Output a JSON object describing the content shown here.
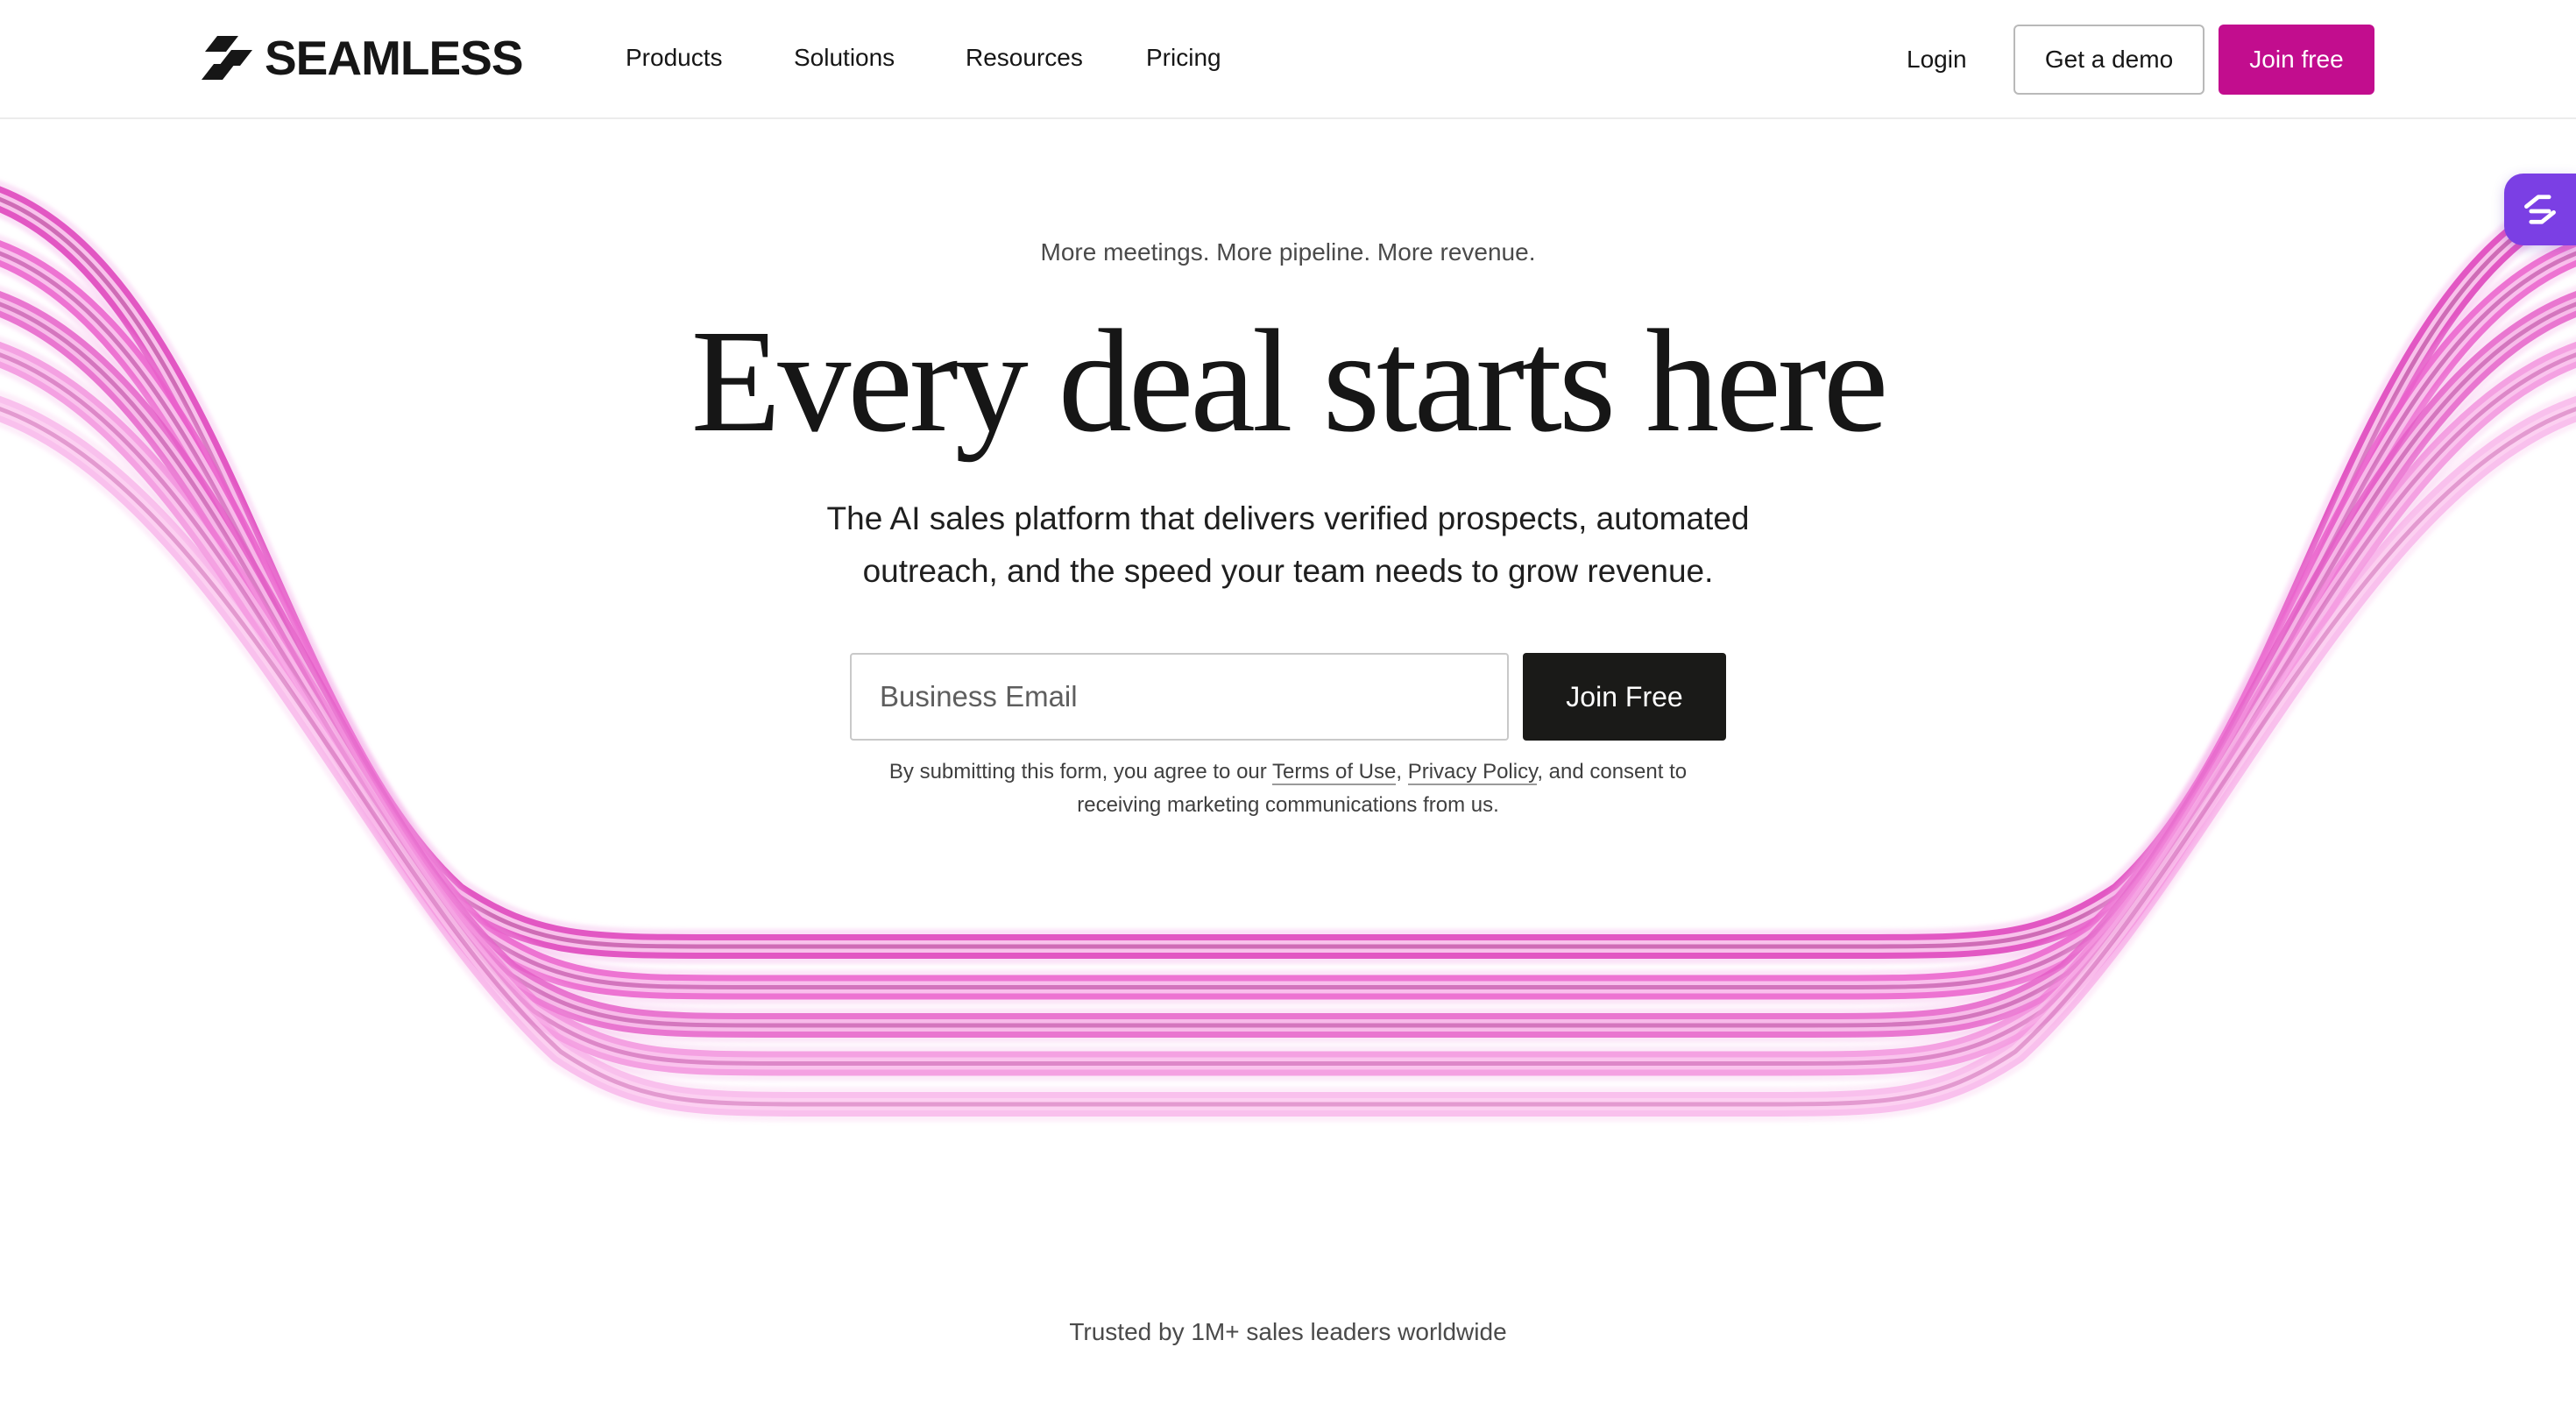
{
  "brand": {
    "name": "SEAMLESS",
    "accent_color": "#c20d8e",
    "widget_color": "#7b3fe4"
  },
  "nav": {
    "items": [
      {
        "label": "Products"
      },
      {
        "label": "Solutions"
      },
      {
        "label": "Resources"
      },
      {
        "label": "Pricing"
      }
    ],
    "login_label": "Login",
    "demo_label": "Get a demo",
    "join_label": "Join free"
  },
  "hero": {
    "eyebrow": "More meetings. More pipeline. More revenue.",
    "headline": "Every deal starts here",
    "subline": "The AI sales platform that delivers verified prospects, automated outreach, and the speed your team needs to grow revenue.",
    "email_placeholder": "Business Email",
    "email_value": "",
    "cta_label": "Join Free",
    "legal": {
      "prefix": "By submitting this form, you agree to our ",
      "terms_label": "Terms of Use",
      "separator": ", ",
      "privacy_label": "Privacy Policy",
      "suffix": ", and consent to receiving marketing communications from us."
    }
  },
  "trusted": {
    "text": "Trusted by 1M+ sales leaders worldwide"
  },
  "icons": {
    "logo": "seamless-logo-icon",
    "widget": "seamless-widget-icon",
    "background": "pink-wave-lines"
  }
}
